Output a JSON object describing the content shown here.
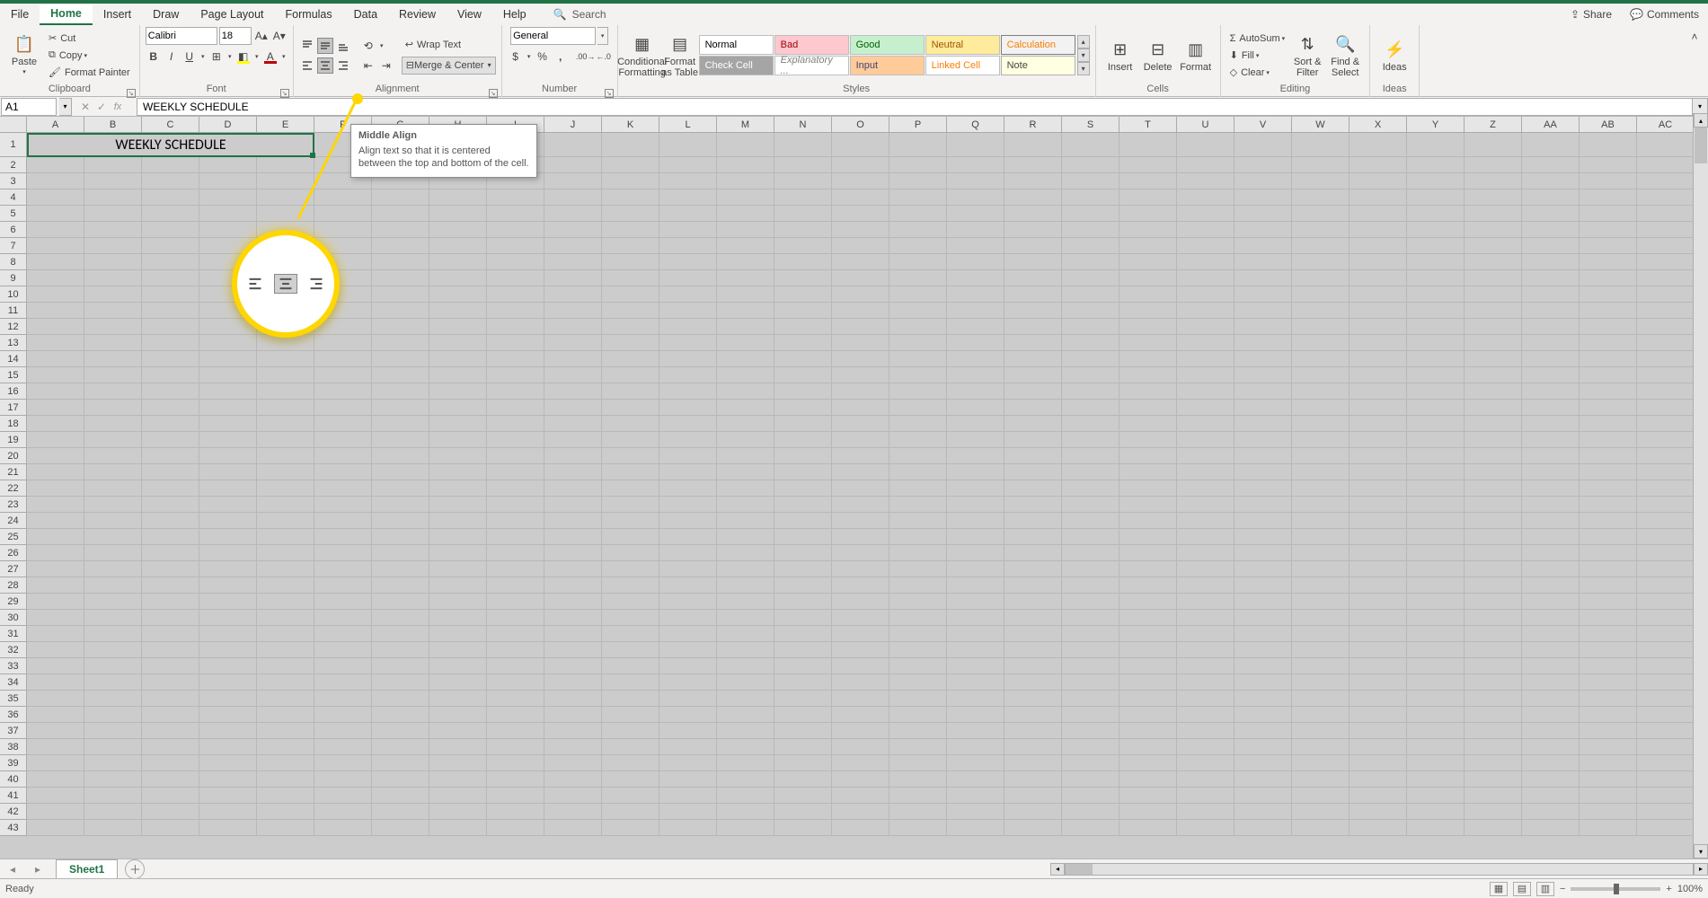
{
  "tabs": {
    "file": "File",
    "home": "Home",
    "insert": "Insert",
    "draw": "Draw",
    "page_layout": "Page Layout",
    "formulas": "Formulas",
    "data": "Data",
    "review": "Review",
    "view": "View",
    "help": "Help"
  },
  "search_placeholder": "Search",
  "share": "Share",
  "comments": "Comments",
  "clipboard": {
    "paste": "Paste",
    "cut": "Cut",
    "copy": "Copy",
    "format_painter": "Format Painter",
    "label": "Clipboard"
  },
  "font": {
    "name": "Calibri",
    "size": "18",
    "label": "Font"
  },
  "alignment": {
    "wrap": "Wrap Text",
    "merge": "Merge & Center",
    "label": "Alignment"
  },
  "number": {
    "format": "General",
    "label": "Number"
  },
  "styles": {
    "cond": "Conditional Formatting",
    "fat": "Format as Table",
    "items": [
      "Normal",
      "Bad",
      "Good",
      "Neutral",
      "Calculation",
      "Check Cell",
      "Explanatory ...",
      "Input",
      "Linked Cell",
      "Note"
    ],
    "label": "Styles"
  },
  "cells": {
    "insert": "Insert",
    "delete": "Delete",
    "format": "Format",
    "label": "Cells"
  },
  "editing": {
    "autosum": "AutoSum",
    "fill": "Fill",
    "clear": "Clear",
    "sort": "Sort & Filter",
    "find": "Find & Select",
    "label": "Editing"
  },
  "ideas": {
    "btn": "Ideas",
    "label": "Ideas"
  },
  "namebox": "A1",
  "formula": "WEEKLY SCHEDULE",
  "merged_cell": "WEEKLY SCHEDULE",
  "columns": [
    "A",
    "B",
    "C",
    "D",
    "E",
    "F",
    "G",
    "H",
    "I",
    "J",
    "K",
    "L",
    "M",
    "N",
    "O",
    "P",
    "Q",
    "R",
    "S",
    "T",
    "U",
    "V",
    "W",
    "X",
    "Y",
    "Z",
    "AA",
    "AB",
    "AC"
  ],
  "tooltip": {
    "title": "Middle Align",
    "body": "Align text so that it is centered between the top and bottom of the cell."
  },
  "sheet_tab": "Sheet1",
  "status": "Ready",
  "zoom": "100%"
}
